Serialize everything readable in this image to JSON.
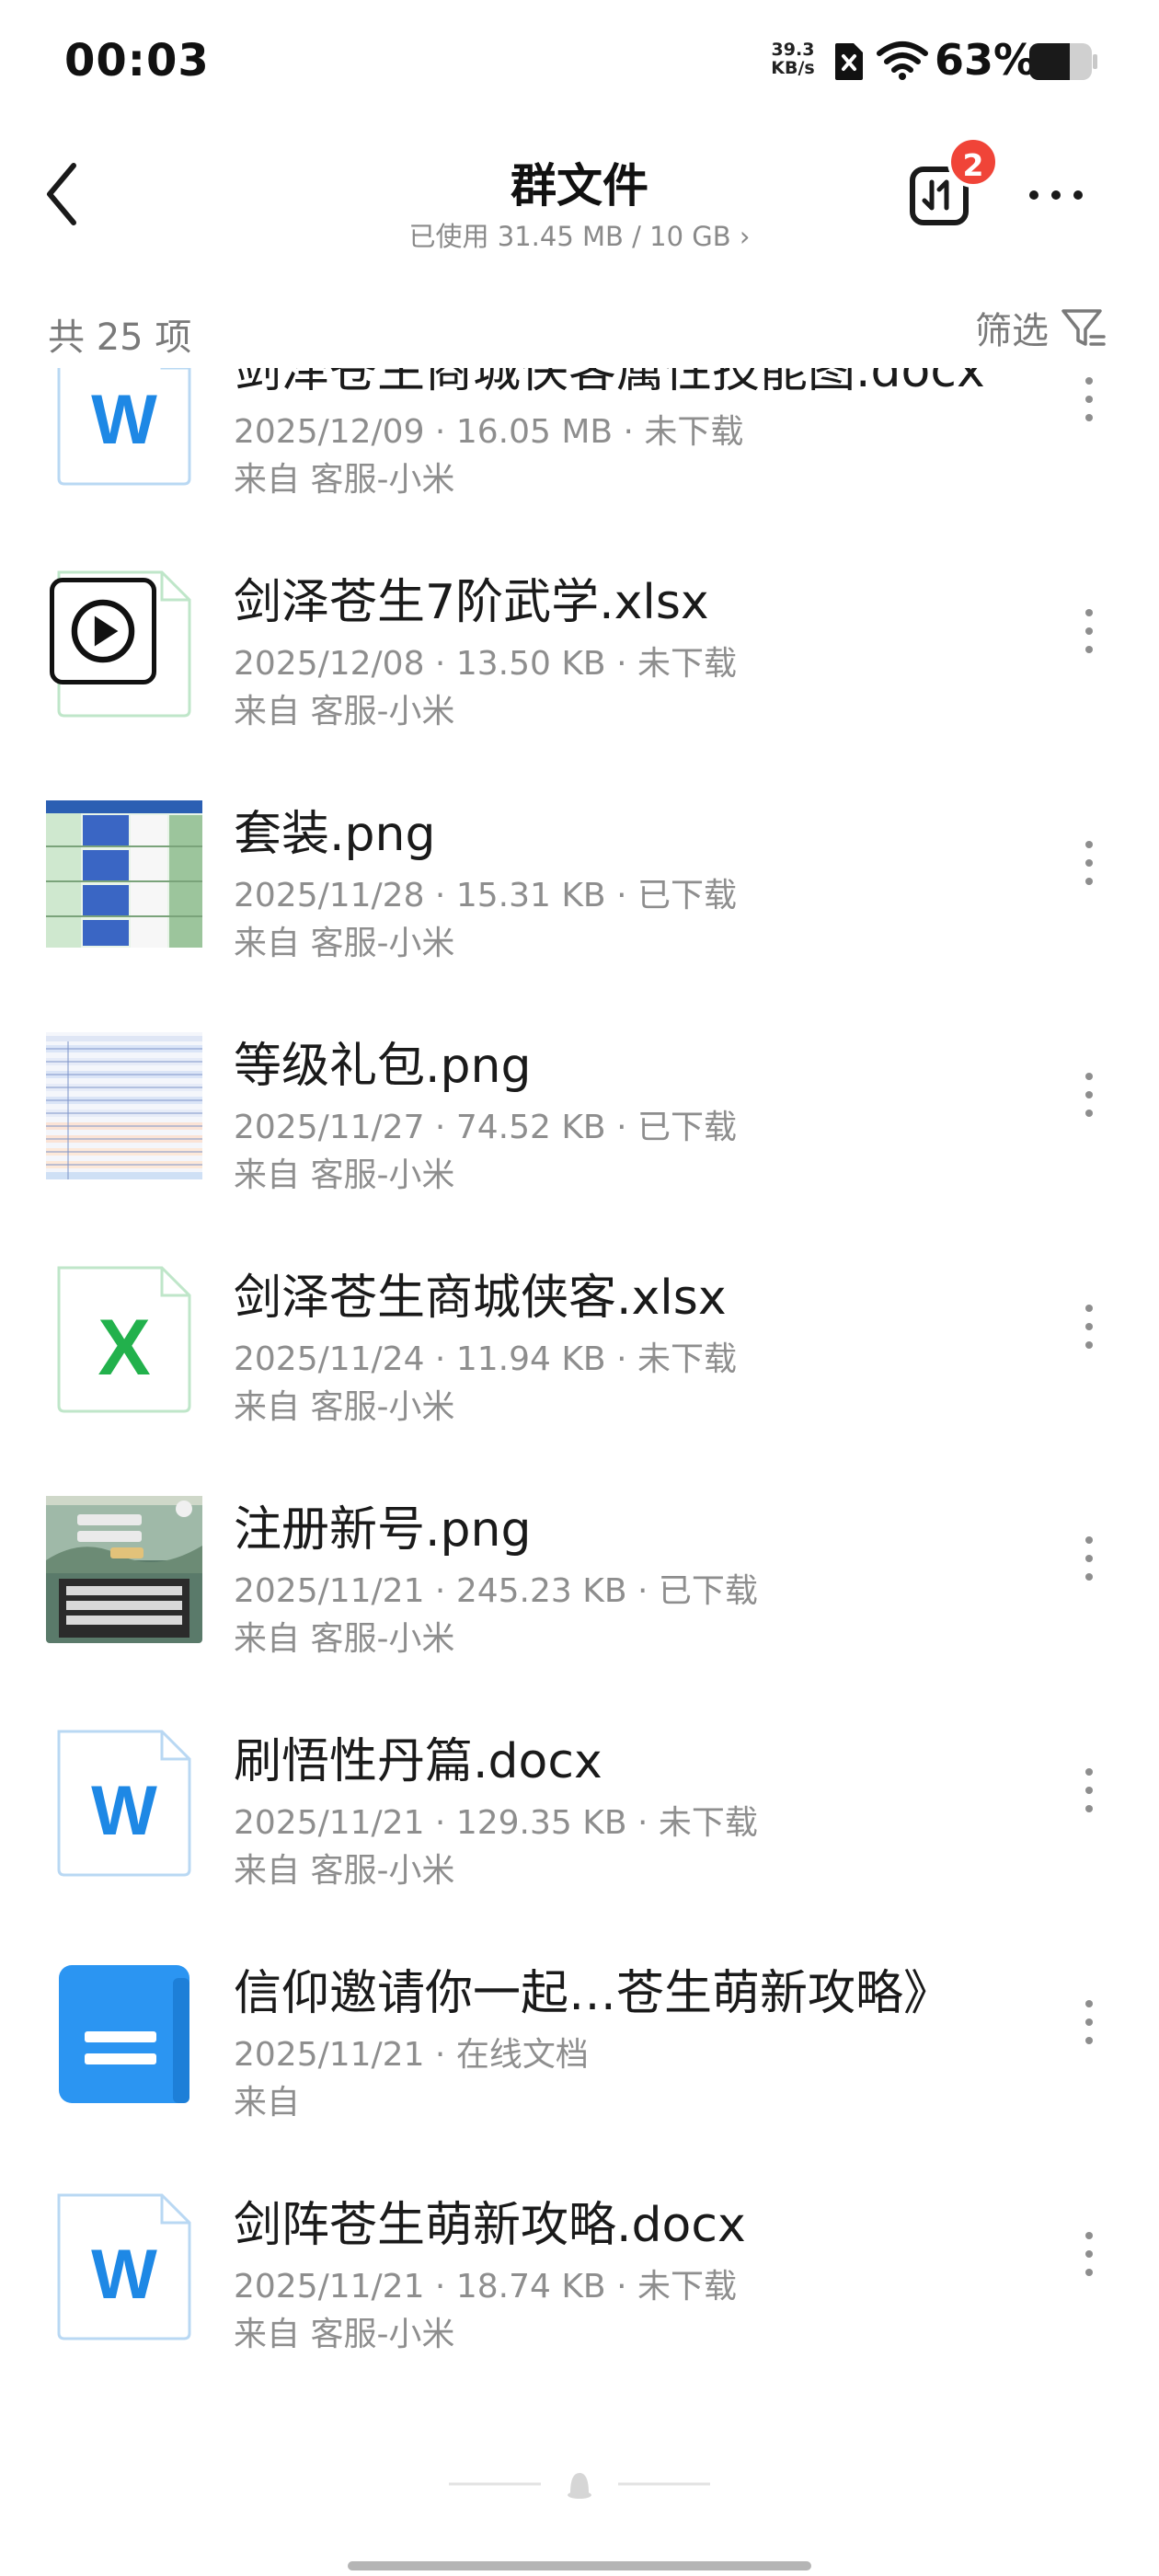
{
  "status_bar": {
    "time": "00:03",
    "net_speed_value": "39.3",
    "net_speed_unit": "KB/s",
    "battery_percent": "63%"
  },
  "header": {
    "title": "群文件",
    "storage_usage": "已使用 31.45 MB / 10 GB",
    "transfer_badge_count": "2"
  },
  "summary": {
    "count_label": "共 25 项",
    "filter_label": "筛选"
  },
  "files": [
    {
      "name": "剑泽苍生商城侠客属性技能图.docx",
      "meta": "2025/12/09 · 16.05 MB · 未下载",
      "source": "来自 客服-小米",
      "type": "word-icon"
    },
    {
      "name": "剑泽苍生7阶武学.xlsx",
      "meta": "2025/12/08 · 13.50 KB · 未下载",
      "source": "来自 客服-小米",
      "type": "excel-icon"
    },
    {
      "name": "套装.png",
      "meta": "2025/11/28 · 15.31 KB · 已下载",
      "source": "来自 客服-小米",
      "type": "image-thumbnail"
    },
    {
      "name": "等级礼包.png",
      "meta": "2025/11/27 · 74.52 KB · 已下载",
      "source": "来自 客服-小米",
      "type": "image-thumbnail"
    },
    {
      "name": "剑泽苍生商城侠客.xlsx",
      "meta": "2025/11/24 · 11.94 KB · 未下载",
      "source": "来自 客服-小米",
      "type": "excel-icon"
    },
    {
      "name": "注册新号.png",
      "meta": "2025/11/21 · 245.23 KB · 已下载",
      "source": "来自 客服-小米",
      "type": "image-thumbnail"
    },
    {
      "name": "刷悟性丹篇.docx",
      "meta": "2025/11/21 · 129.35 KB · 未下载",
      "source": "来自 客服-小米",
      "type": "word-icon"
    },
    {
      "name": "信仰邀请你一起…苍生萌新攻略》",
      "meta": "2025/11/21 · 在线文档",
      "source": "来自",
      "type": "online-doc-icon"
    },
    {
      "name": "剑阵苍生萌新攻略.docx",
      "meta": "2025/11/21 · 18.74 KB · 未下载",
      "source": "来自 客服-小米",
      "type": "word-icon"
    }
  ],
  "colors": {
    "word_blue": "#1e88e5",
    "excel_green": "#22b14c",
    "online_doc_blue": "#2b95f2",
    "badge_red": "#f04438",
    "muted_text": "#8e8e8e"
  }
}
